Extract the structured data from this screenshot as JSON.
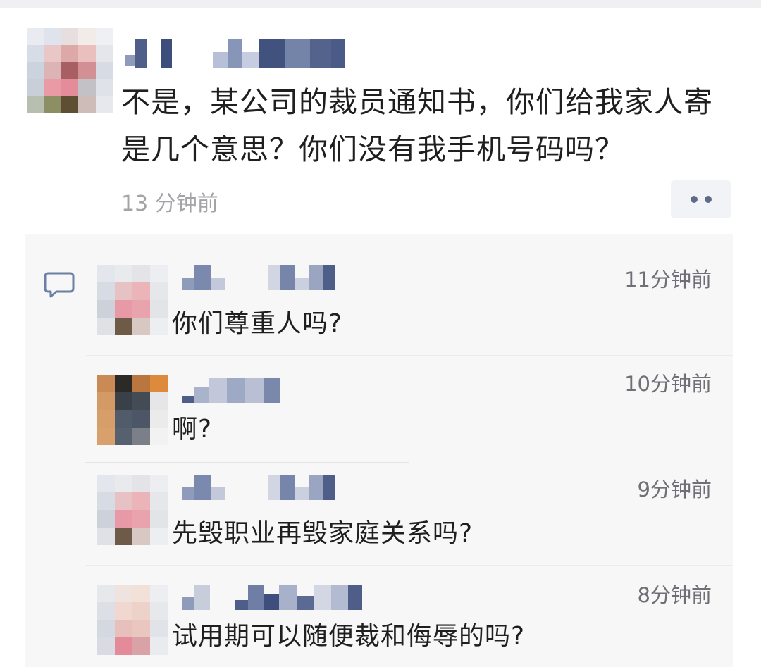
{
  "post": {
    "text": "不是，某公司的裁员通知书，你们给我家人寄是几个意思？你们没有我手机号码吗？",
    "time": "13 分钟前"
  },
  "more_button": {
    "label": "••"
  },
  "comments": [
    {
      "text": "你们尊重人吗?",
      "time": "11分钟前"
    },
    {
      "text": "啊?",
      "time": "10分钟前"
    },
    {
      "text": "先毁职业再毁家庭关系吗?",
      "time": "9分钟前"
    },
    {
      "text": "试用期可以随便裁和侮辱的吗?",
      "time": "8分钟前"
    }
  ],
  "colors": {
    "muted_text": "#a3a3a8",
    "time_text": "#6f6f75",
    "panel_bg": "#f7f7f7",
    "accent_blue": "#5c6b8a"
  },
  "icons": {
    "comment": "comment-bubble-icon",
    "more": "more-dots-icon"
  }
}
